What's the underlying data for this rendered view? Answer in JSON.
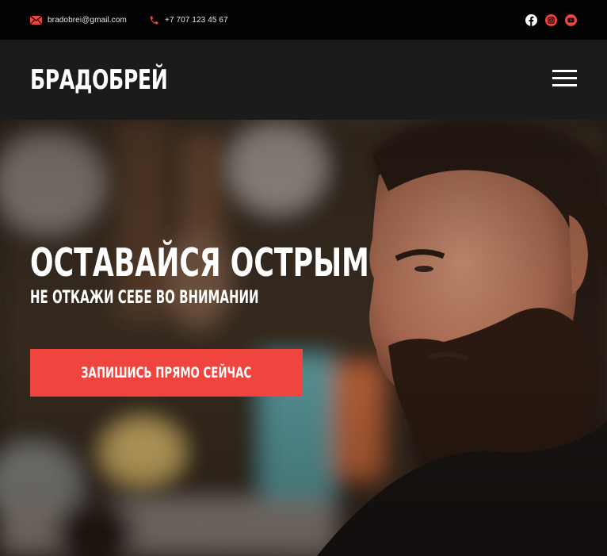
{
  "topbar": {
    "email": "bradobrei@gmail.com",
    "phone": "+7 707 123 45 67",
    "socials": [
      "facebook-icon",
      "instagram-icon",
      "youtube-icon"
    ]
  },
  "header": {
    "logo": "БРАДОБРЕЙ",
    "menu_icon": "hamburger-menu-icon"
  },
  "hero": {
    "title": "ОСТАВАЙСЯ ОСТРЫМ",
    "subtitle": "НЕ ОТКАЖИ СЕБЕ ВО ВНИМАНИИ",
    "cta_label": "ЗАПИШИСЬ ПРЯМО СЕЙЧАС",
    "image": "bearded man in barbershop photo"
  },
  "colors": {
    "accent": "#f0443f",
    "topbar_bg": "#030303",
    "header_bg": "#1b1b1b",
    "text": "#ffffff"
  }
}
